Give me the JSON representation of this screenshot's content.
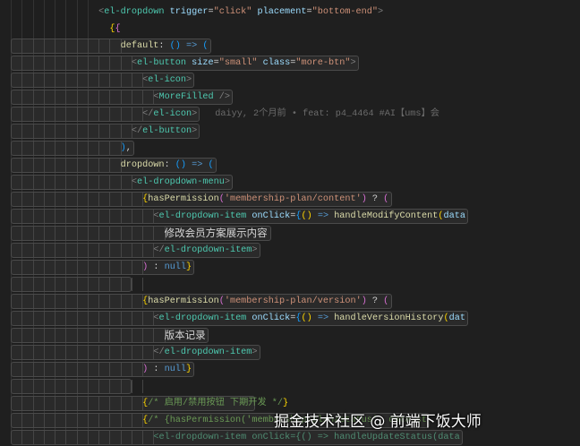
{
  "colors": {
    "background": "#1f1f1f",
    "tag": "#4ec9b0",
    "attribute": "#9cdcfe",
    "string": "#ce9178",
    "comment": "#6a9955"
  },
  "code_lines": [
    {
      "indent": 9,
      "boxed": false,
      "tokens": [
        [
          "<",
          "pun"
        ],
        [
          "el-dropdown",
          "tag"
        ],
        [
          " trigger",
          "attr"
        ],
        [
          "=",
          "def"
        ],
        [
          "\"click\"",
          "str"
        ],
        [
          " placement",
          "attr"
        ],
        [
          "=",
          "def"
        ],
        [
          "\"bottom-end\"",
          "str"
        ],
        [
          ">",
          "pun"
        ]
      ]
    },
    {
      "indent": 10,
      "boxed": false,
      "tokens": [
        [
          "{",
          "y"
        ],
        [
          "{",
          "p"
        ]
      ]
    },
    {
      "indent": 11,
      "boxed": true,
      "tokens": [
        [
          "default",
          "fn"
        ],
        [
          ": ",
          "def"
        ],
        [
          "()",
          "b"
        ],
        [
          " => ",
          "kw"
        ],
        [
          "(",
          "b"
        ]
      ]
    },
    {
      "indent": 12,
      "boxed": true,
      "tokens": [
        [
          "<",
          "pun"
        ],
        [
          "el-button",
          "tag"
        ],
        [
          " size",
          "attr"
        ],
        [
          "=",
          "def"
        ],
        [
          "\"small\"",
          "str"
        ],
        [
          " class",
          "attr"
        ],
        [
          "=",
          "def"
        ],
        [
          "\"more-btn\"",
          "str"
        ],
        [
          ">",
          "pun"
        ]
      ]
    },
    {
      "indent": 13,
      "boxed": true,
      "tokens": [
        [
          "<",
          "pun"
        ],
        [
          "el-icon",
          "tag"
        ],
        [
          ">",
          "pun"
        ]
      ]
    },
    {
      "indent": 14,
      "boxed": true,
      "tokens": [
        [
          "<",
          "pun"
        ],
        [
          "MoreFilled",
          "tag"
        ],
        [
          " />",
          "pun"
        ]
      ]
    },
    {
      "indent": 13,
      "boxed": true,
      "tokens": [
        [
          "</",
          "pun"
        ],
        [
          "el-icon",
          "tag"
        ],
        [
          ">",
          "pun"
        ]
      ],
      "blame": "daiyy, 2个月前 • feat: p4_4464 #AI【ums】会"
    },
    {
      "indent": 12,
      "boxed": true,
      "tokens": [
        [
          "</",
          "pun"
        ],
        [
          "el-button",
          "tag"
        ],
        [
          ">",
          "pun"
        ]
      ]
    },
    {
      "indent": 11,
      "boxed": true,
      "tokens": [
        [
          ")",
          "b"
        ],
        [
          ",",
          "def"
        ]
      ]
    },
    {
      "indent": 11,
      "boxed": true,
      "tokens": [
        [
          "dropdown",
          "fn"
        ],
        [
          ": ",
          "def"
        ],
        [
          "()",
          "b"
        ],
        [
          " => ",
          "kw"
        ],
        [
          "(",
          "b"
        ]
      ]
    },
    {
      "indent": 12,
      "boxed": true,
      "tokens": [
        [
          "<",
          "pun"
        ],
        [
          "el-dropdown-menu",
          "tag"
        ],
        [
          ">",
          "pun"
        ]
      ]
    },
    {
      "indent": 13,
      "boxed": true,
      "tokens": [
        [
          "{",
          "y"
        ],
        [
          "hasPermission",
          "fn"
        ],
        [
          "(",
          "p"
        ],
        [
          "'membership-plan/content'",
          "str"
        ],
        [
          ")",
          "p"
        ],
        [
          " ? ",
          "def"
        ],
        [
          "(",
          "p"
        ]
      ]
    },
    {
      "indent": 14,
      "boxed": true,
      "tokens": [
        [
          "<",
          "pun"
        ],
        [
          "el-dropdown-item",
          "tag"
        ],
        [
          " onClick",
          "attr"
        ],
        [
          "=",
          "def"
        ],
        [
          "{",
          "b"
        ],
        [
          "()",
          "y"
        ],
        [
          " => ",
          "kw"
        ],
        [
          "handleModifyContent",
          "fn"
        ],
        [
          "(",
          "y"
        ],
        [
          "data",
          "attr"
        ]
      ]
    },
    {
      "indent": 15,
      "boxed": true,
      "tokens": [
        [
          "修改会员方案展示内容",
          "zh"
        ]
      ]
    },
    {
      "indent": 14,
      "boxed": true,
      "tokens": [
        [
          "</",
          "pun"
        ],
        [
          "el-dropdown-item",
          "tag"
        ],
        [
          ">",
          "pun"
        ]
      ]
    },
    {
      "indent": 13,
      "boxed": true,
      "tokens": [
        [
          ")",
          "p"
        ],
        [
          " : ",
          "def"
        ],
        [
          "null",
          "kw"
        ],
        [
          "}",
          "y"
        ]
      ]
    },
    {
      "indent": 13,
      "boxed": true,
      "empty": true,
      "tokens": []
    },
    {
      "indent": 13,
      "boxed": true,
      "tokens": [
        [
          "{",
          "y"
        ],
        [
          "hasPermission",
          "fn"
        ],
        [
          "(",
          "p"
        ],
        [
          "'membership-plan/version'",
          "str"
        ],
        [
          ")",
          "p"
        ],
        [
          " ? ",
          "def"
        ],
        [
          "(",
          "p"
        ]
      ]
    },
    {
      "indent": 14,
      "boxed": true,
      "tokens": [
        [
          "<",
          "pun"
        ],
        [
          "el-dropdown-item",
          "tag"
        ],
        [
          " onClick",
          "attr"
        ],
        [
          "=",
          "def"
        ],
        [
          "{",
          "b"
        ],
        [
          "()",
          "y"
        ],
        [
          " => ",
          "kw"
        ],
        [
          "handleVersionHistory",
          "fn"
        ],
        [
          "(",
          "y"
        ],
        [
          "dat",
          "attr"
        ]
      ]
    },
    {
      "indent": 15,
      "boxed": true,
      "tokens": [
        [
          "版本记录",
          "zh"
        ]
      ]
    },
    {
      "indent": 14,
      "boxed": true,
      "tokens": [
        [
          "</",
          "pun"
        ],
        [
          "el-dropdown-item",
          "tag"
        ],
        [
          ">",
          "pun"
        ]
      ]
    },
    {
      "indent": 13,
      "boxed": true,
      "tokens": [
        [
          ")",
          "p"
        ],
        [
          " : ",
          "def"
        ],
        [
          "null",
          "kw"
        ],
        [
          "}",
          "y"
        ]
      ]
    },
    {
      "indent": 13,
      "boxed": true,
      "empty": true,
      "tokens": []
    },
    {
      "indent": 13,
      "boxed": true,
      "tokens": [
        [
          "{",
          "y"
        ],
        [
          "/* 启用/禁用按钮 下期开发 */",
          "cm"
        ],
        [
          "}",
          "y"
        ]
      ]
    },
    {
      "indent": 13,
      "boxed": true,
      "tokens": [
        [
          "{",
          "y"
        ],
        [
          "/* {hasPermission('membership-plan/status', data.st",
          "cm"
        ]
      ]
    },
    {
      "indent": 14,
      "boxed": true,
      "tokens": [
        [
          "<el-dropdown-item onClick={() => handleUpdateStatus(data",
          "cm2"
        ]
      ]
    }
  ],
  "watermark": "掘金技术社区 @ 前端下饭大师"
}
